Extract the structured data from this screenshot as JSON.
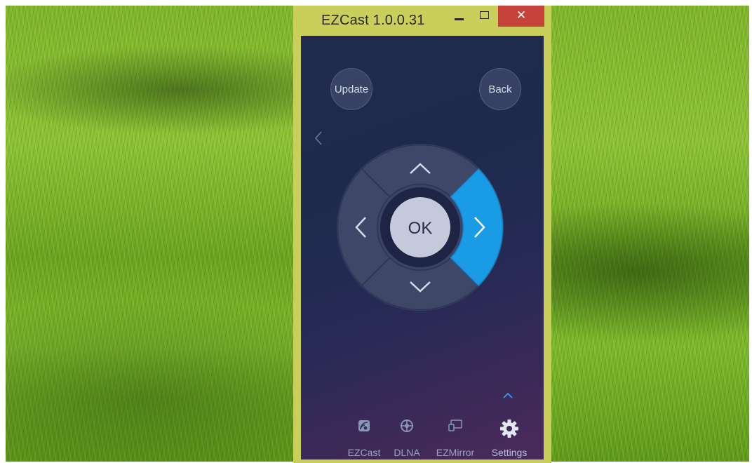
{
  "window": {
    "title": "EZCast 1.0.0.31",
    "close_glyph": "✕"
  },
  "app": {
    "update_label": "Update",
    "back_label": "Back",
    "ok_label": "OK",
    "active_direction": "right"
  },
  "nav": {
    "items": [
      {
        "label": "EZCast",
        "icon": "ezcast-icon"
      },
      {
        "label": "DLNA",
        "icon": "dlna-icon"
      },
      {
        "label": "EZMirror",
        "icon": "ezmirror-icon"
      },
      {
        "label": "Settings",
        "icon": "gear-icon"
      }
    ],
    "selected": "Settings"
  },
  "colors": {
    "window_frame": "#c9cf5a",
    "close_button": "#c7423a",
    "highlight": "#1a9be6",
    "background_top": "#202b4e",
    "background_bottom": "#4a2a5c"
  }
}
